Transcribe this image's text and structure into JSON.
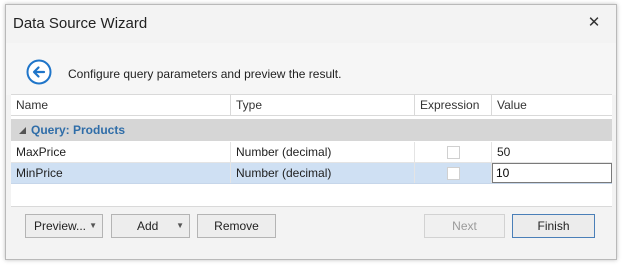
{
  "window": {
    "title": "Data Source Wizard",
    "close_glyph": "✕"
  },
  "header": {
    "back_icon": "back-arrow-circle-icon",
    "description": "Configure query parameters and preview the result."
  },
  "grid": {
    "columns": [
      "Name",
      "Type",
      "Expression",
      "Value"
    ],
    "group_label": "Query: Products",
    "rows": [
      {
        "name": "MaxPrice",
        "type": "Number (decimal)",
        "expression": false,
        "value": "50"
      },
      {
        "name": "MinPrice",
        "type": "Number (decimal)",
        "expression": false,
        "value": "10"
      }
    ]
  },
  "buttons": {
    "preview": "Preview...",
    "add": "Add",
    "remove": "Remove",
    "next": "Next",
    "finish": "Finish"
  },
  "colors": {
    "accent": "#2f6da8",
    "selected_row": "#cfe0f3",
    "group_bg": "#d6d6d6"
  }
}
